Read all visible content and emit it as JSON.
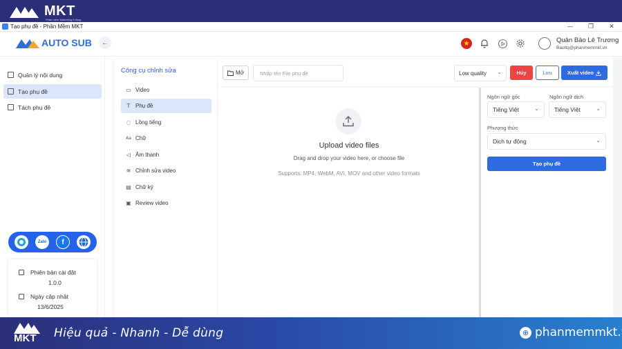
{
  "banner_top": {
    "brand": "MKT",
    "tagline": "Phần mềm Marketing 0 đồng"
  },
  "window": {
    "title": "Tạo phụ đề - Phần Mềm MKT",
    "controls": [
      "—",
      "❐",
      "✕"
    ]
  },
  "header": {
    "logo_text": "AUTO SUB",
    "collapse_icon": "chevron-left-icon",
    "user_name": "Quân Bảo Lê Trương",
    "user_email": "Baottq@phanmemmkt.vn",
    "language_flag": "vietnam-flag"
  },
  "sidebar": {
    "items": [
      {
        "label": "Quản lý nội dung",
        "icon": "document-icon",
        "active": false
      },
      {
        "label": "Tạo phụ đề",
        "icon": "subtitle-icon",
        "active": true
      },
      {
        "label": "Tách phụ đề",
        "icon": "split-icon",
        "active": false
      }
    ],
    "socials": [
      "support-icon",
      "zalo-icon",
      "facebook-icon",
      "globe-icon"
    ],
    "zalo_label": "Zalo",
    "facebook_label": "f",
    "version_label": "Phiên bản cài đặt",
    "version_value": "1.0.0",
    "update_label": "Ngày cập nhật",
    "update_value": "13/6/2025"
  },
  "tools": {
    "title": "Công cụ chỉnh sửa",
    "items": [
      {
        "label": "Video",
        "icon": "video-icon",
        "glyph": "▭",
        "active": false
      },
      {
        "label": "Phụ đề",
        "icon": "text-icon",
        "glyph": "T",
        "active": true
      },
      {
        "label": "Lồng tiếng",
        "icon": "voice-icon",
        "glyph": "◌",
        "active": false
      },
      {
        "label": "Chữ",
        "icon": "font-icon",
        "glyph": "Aa",
        "active": false
      },
      {
        "label": "Âm thanh",
        "icon": "speaker-icon",
        "glyph": "◁",
        "active": false
      },
      {
        "label": "Chỉnh sửa video",
        "icon": "layers-icon",
        "glyph": "≋",
        "active": false
      },
      {
        "label": "Chữ ký",
        "icon": "signature-icon",
        "glyph": "▤",
        "active": false
      },
      {
        "label": "Review video",
        "icon": "image-icon",
        "glyph": "▣",
        "active": false
      }
    ]
  },
  "toolbar": {
    "open_label": "Mở",
    "filename_placeholder": "Nhập tên File phụ đề",
    "quality_value": "Low quality",
    "cancel_label": "Hủy",
    "save_label": "Lưu",
    "export_label": "Xuất video"
  },
  "upload": {
    "title": "Upload video files",
    "subtitle": "Drag and drop your video here, or choose file",
    "formats": "Supports: MP4, WebM, AVI, MOV and other video formats"
  },
  "settings": {
    "source_lang_label": "Ngôn ngữ gốc",
    "source_lang_value": "Tiếng Việt",
    "target_lang_label": "Ngôn ngữ dịch",
    "target_lang_value": "Tiếng Việt",
    "method_label": "Phương thức",
    "method_value": "Dịch tự động",
    "create_label": "Tạo phụ đề"
  },
  "banner_bottom": {
    "brand": "MKT",
    "slogan": "Hiệu quả - Nhanh  - Dễ dùng",
    "site": "phanmemmkt.vn"
  },
  "colors": {
    "primary": "#2f6be0",
    "danger": "#ef4444",
    "banner": "#2b2f78",
    "active_bg": "#dbe6fb"
  }
}
